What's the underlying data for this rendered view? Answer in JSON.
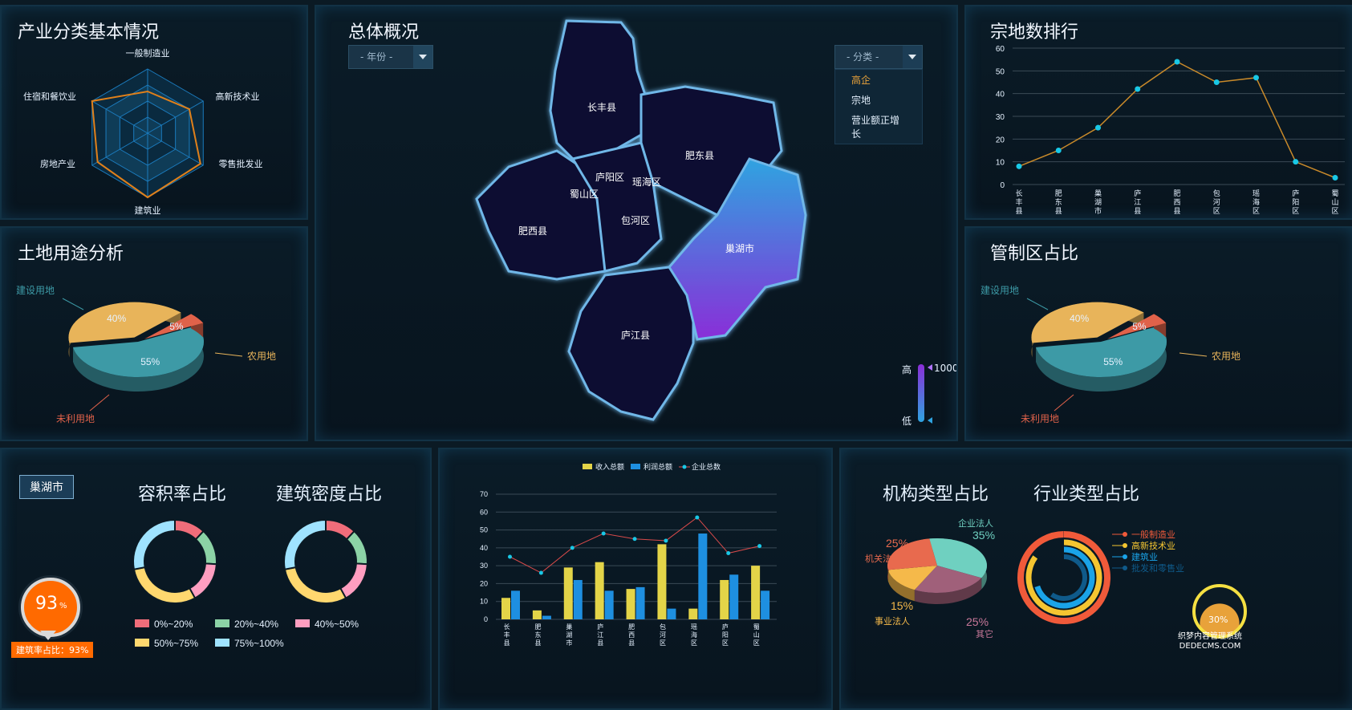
{
  "panels": {
    "industry_title": "产业分类基本情况",
    "overview_title": "总体概况",
    "rank_title": "宗地数排行",
    "land_title": "土地用途分析",
    "control_title": "管制区占比",
    "far_title": "容积率占比",
    "density_title": "建筑密度占比",
    "org_title": "机构类型占比",
    "ind_type_title": "行业类型占比"
  },
  "overview": {
    "year_dropdown": "- 年份 -",
    "category_dropdown": "- 分类 -",
    "category_options": [
      "高企",
      "宗地",
      "营业额正增长"
    ],
    "legend_high": "高",
    "legend_low": "低",
    "legend_max": "1000"
  },
  "map": {
    "regions": [
      "长丰县",
      "肥东县",
      "庐阳区",
      "瑶海区",
      "蜀山区",
      "包河区",
      "肥西县",
      "巢湖市",
      "庐江县"
    ]
  },
  "badge": {
    "city": "巢湖市"
  },
  "gauge_left": {
    "value": "93",
    "unit": "%",
    "label": "建筑率占比：93%"
  },
  "gauge_right": {
    "value": "30%"
  },
  "watermark": "织梦内容管理系统\nDEDECMS.COM",
  "chart_data": [
    {
      "id": "industry-radar",
      "type": "radar",
      "indicators": [
        "一般制造业",
        "高新技术业",
        "零售批发业",
        "建筑业",
        "房地产业",
        "住宿和餐饮业"
      ],
      "values": [
        0.65,
        0.75,
        0.95,
        1.0,
        0.9,
        1.0
      ],
      "max": 1.0
    },
    {
      "id": "rank-line",
      "type": "line",
      "categories": [
        "长丰县",
        "肥东县",
        "巢湖市",
        "庐江县",
        "肥西县",
        "包河区",
        "瑶海区",
        "庐阳区",
        "蜀山区"
      ],
      "values": [
        8,
        15,
        25,
        42,
        54,
        45,
        47,
        10,
        3
      ],
      "ylim": [
        0,
        60
      ],
      "yticks": [
        0,
        10,
        20,
        30,
        40,
        50,
        60
      ]
    },
    {
      "id": "land-pie",
      "type": "pie",
      "slices": [
        {
          "label": "建设用地",
          "value": 55,
          "color": "#3d9aa6"
        },
        {
          "label": "农用地",
          "value": 40,
          "color": "#e8b45a"
        },
        {
          "label": "未利用地",
          "value": 5,
          "color": "#e0624a"
        }
      ]
    },
    {
      "id": "control-pie",
      "type": "pie",
      "slices": [
        {
          "label": "建设用地",
          "value": 55,
          "color": "#3d9aa6"
        },
        {
          "label": "农用地",
          "value": 40,
          "color": "#e8b45a"
        },
        {
          "label": "未利用地",
          "value": 5,
          "color": "#e0624a"
        }
      ]
    },
    {
      "id": "far-donut",
      "type": "pie",
      "slices": [
        {
          "label": "0%~20%",
          "value": 12,
          "color": "#f06d7a"
        },
        {
          "label": "20%~40%",
          "value": 14,
          "color": "#8cd3a6"
        },
        {
          "label": "40%~50%",
          "value": 16,
          "color": "#ff9ec0"
        },
        {
          "label": "50%~75%",
          "value": 30,
          "color": "#ffd86f"
        },
        {
          "label": "75%~100%",
          "value": 28,
          "color": "#9fe3ff"
        }
      ]
    },
    {
      "id": "density-donut",
      "type": "pie",
      "slices": [
        {
          "label": "0%~20%",
          "value": 12,
          "color": "#f06d7a"
        },
        {
          "label": "20%~40%",
          "value": 14,
          "color": "#8cd3a6"
        },
        {
          "label": "40%~50%",
          "value": 16,
          "color": "#ff9ec0"
        },
        {
          "label": "50%~75%",
          "value": 30,
          "color": "#ffd86f"
        },
        {
          "label": "75%~100%",
          "value": 28,
          "color": "#9fe3ff"
        }
      ]
    },
    {
      "id": "revenue-combo",
      "type": "bar",
      "categories": [
        "长丰县",
        "肥东县",
        "巢湖市",
        "庐江县",
        "肥西县",
        "包河区",
        "瑶海区",
        "庐阳区",
        "蜀山区"
      ],
      "series": [
        {
          "name": "收入总额",
          "type": "bar",
          "color": "#e3d448",
          "values": [
            12,
            5,
            29,
            32,
            17,
            42,
            6,
            22,
            30
          ]
        },
        {
          "name": "利润总额",
          "type": "bar",
          "color": "#1e8fe0",
          "values": [
            16,
            2,
            22,
            16,
            18,
            6,
            48,
            25,
            16
          ]
        },
        {
          "name": "企业总数",
          "type": "line",
          "color": "#d84a4a",
          "values": [
            35,
            26,
            40,
            48,
            45,
            44,
            57,
            37,
            41
          ]
        }
      ],
      "ylim": [
        0,
        70
      ],
      "yticks": [
        0,
        10,
        20,
        30,
        40,
        50,
        60,
        70
      ]
    },
    {
      "id": "org-pie",
      "type": "pie",
      "slices": [
        {
          "label": "企业法人",
          "value": 35,
          "percent": "35%",
          "color": "#6fd0c0"
        },
        {
          "label": "其它",
          "value": 25,
          "percent": "25%",
          "color": "#a0607a"
        },
        {
          "label": "事业法人",
          "value": 15,
          "percent": "15%",
          "color": "#f5b94a"
        },
        {
          "label": "机关法人",
          "value": 25,
          "percent": "25%",
          "color": "#e86a4e"
        }
      ]
    },
    {
      "id": "industry-rings",
      "type": "pie",
      "legend": [
        {
          "label": "一般制造业",
          "color": "#f05a3a"
        },
        {
          "label": "高新技术业",
          "color": "#f5c531"
        },
        {
          "label": "建筑业",
          "color": "#1aa3e8"
        },
        {
          "label": "批发和零售业",
          "color": "#0f5a8a"
        }
      ]
    }
  ]
}
